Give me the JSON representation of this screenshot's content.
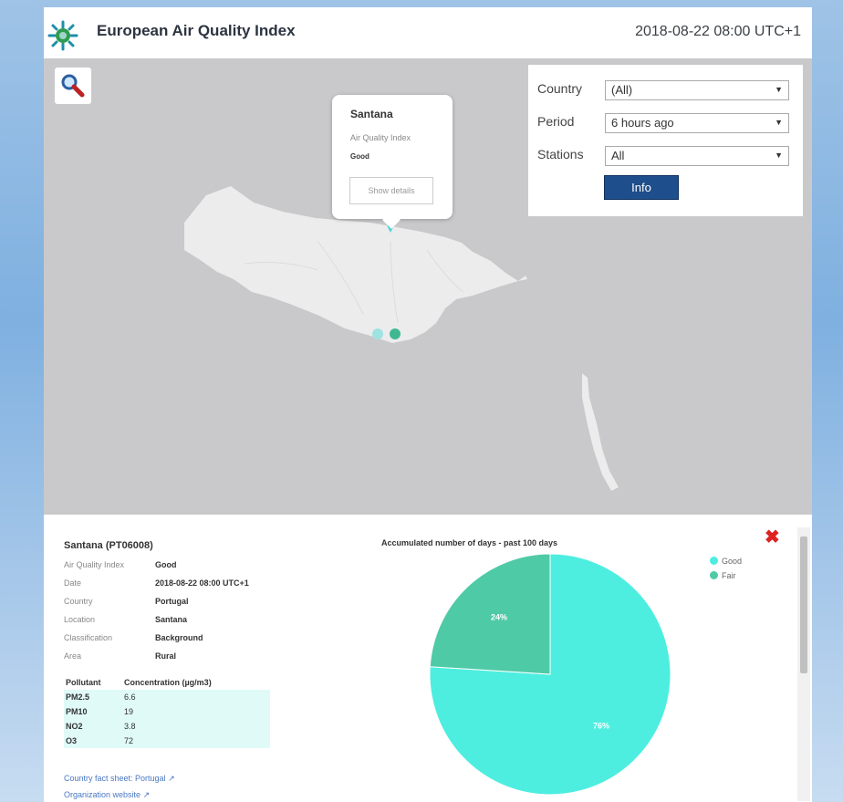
{
  "header": {
    "title": "European Air Quality Index",
    "timestamp": "2018-08-22 08:00 UTC+1"
  },
  "map": {
    "popup": {
      "station": "Santana",
      "label": "Air Quality Index",
      "value": "Good",
      "button": "Show details"
    },
    "filters": {
      "country_label": "Country",
      "country_value": "(All)",
      "period_label": "Period",
      "period_value": "6 hours ago",
      "stations_label": "Stations",
      "stations_value": "All",
      "info_button": "Info"
    },
    "markers": [
      {
        "station": "Santana",
        "status": "Good",
        "color": "#4fd1d9"
      },
      {
        "status": "Good",
        "color": "#9fe2e2"
      },
      {
        "status": "Fair",
        "color": "#3fb892"
      }
    ]
  },
  "details": {
    "station_title": "Santana (PT06008)",
    "attributes": [
      {
        "label": "Air Quality Index",
        "value": "Good"
      },
      {
        "label": "Date",
        "value": "2018-08-22 08:00 UTC+1"
      },
      {
        "label": "Country",
        "value": "Portugal"
      },
      {
        "label": "Location",
        "value": "Santana"
      },
      {
        "label": "Classification",
        "value": "Background"
      },
      {
        "label": "Area",
        "value": "Rural"
      }
    ],
    "pollutant_header": "Pollutant",
    "concentration_header": "Concentration (µg/m3)",
    "pollutants": [
      {
        "name": "PM2.5",
        "value": "6.6"
      },
      {
        "name": "PM10",
        "value": "19"
      },
      {
        "name": "NO2",
        "value": "3.8"
      },
      {
        "name": "O3",
        "value": "72"
      }
    ],
    "links": {
      "country_fact": "Country fact sheet: Portugal",
      "org_site": "Organization website"
    }
  },
  "chart_data": {
    "type": "pie",
    "title": "Accumulated number of days - past 100 days",
    "categories": [
      "Good",
      "Fair"
    ],
    "values": [
      76,
      24
    ],
    "labels": [
      "76%",
      "24%"
    ],
    "colors": [
      "#4deee0",
      "#4fcaa6"
    ],
    "legend_position": "top-right"
  }
}
